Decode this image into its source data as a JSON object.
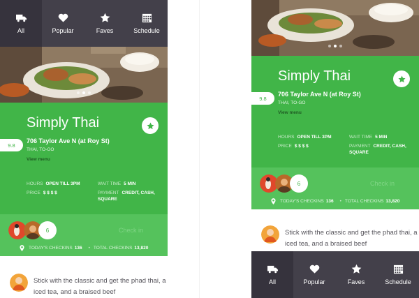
{
  "tabs": [
    {
      "label": "All",
      "icon": "truck-icon"
    },
    {
      "label": "Popular",
      "icon": "heart-icon"
    },
    {
      "label": "Faves",
      "icon": "star-icon"
    },
    {
      "label": "Schedule",
      "icon": "calendar-icon"
    }
  ],
  "carousel": {
    "pages": 3,
    "active_index": 1
  },
  "restaurant": {
    "name": "Simply Thai",
    "score": "9.8",
    "address": "706 Taylor Ave N (at Roy St)",
    "cuisine": "THAI, TO-GO",
    "view_menu": "View menu",
    "hours_label": "HOURS",
    "hours_value": "OPEN TILL 3PM",
    "wait_label": "WAIT TIME",
    "wait_value": "5 MIN",
    "price_label": "PRICE",
    "price_value": "$ $ $ $",
    "payment_label": "PAYMENT",
    "payment_value": "CREDIT, CASH, SQUARE"
  },
  "checkins": {
    "count": "6",
    "check_in_label": "Check in",
    "todays_label": "TODAY'S CHECKINS",
    "todays_value": "136",
    "total_label": "TOTAL CHECKINS",
    "total_value": "13,820"
  },
  "comment": {
    "text": "Stick with the classic and get the phad thai, a thai iced tea, and a braised beef"
  },
  "colors": {
    "green": "#41b548",
    "green_light": "#55c25c",
    "tabbar": "#43404a",
    "tabbar_active": "#36333d"
  }
}
